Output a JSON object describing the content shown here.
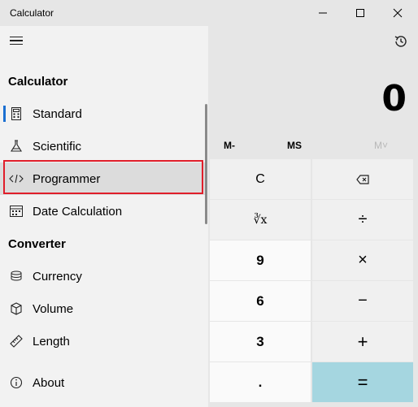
{
  "window": {
    "title": "Calculator"
  },
  "display": {
    "value": "0"
  },
  "memory": {
    "mminus": "M-",
    "ms": "MS",
    "mlist": "M˅"
  },
  "keys": {
    "c": "C",
    "root": "∛x",
    "divide": "÷",
    "n9": "9",
    "multiply": "×",
    "n6": "6",
    "minus": "−",
    "n3": "3",
    "plus": "+",
    "dot": ".",
    "equals": "="
  },
  "nav": {
    "calculator_header": "Calculator",
    "converter_header": "Converter",
    "items": {
      "standard": "Standard",
      "scientific": "Scientific",
      "programmer": "Programmer",
      "date": "Date Calculation",
      "currency": "Currency",
      "volume": "Volume",
      "length": "Length",
      "about": "About"
    },
    "selected": "Programmer"
  },
  "colors": {
    "accent": "#1a6fd1",
    "equals_key": "#a5d6e0",
    "highlight_border": "#e01e2a"
  }
}
